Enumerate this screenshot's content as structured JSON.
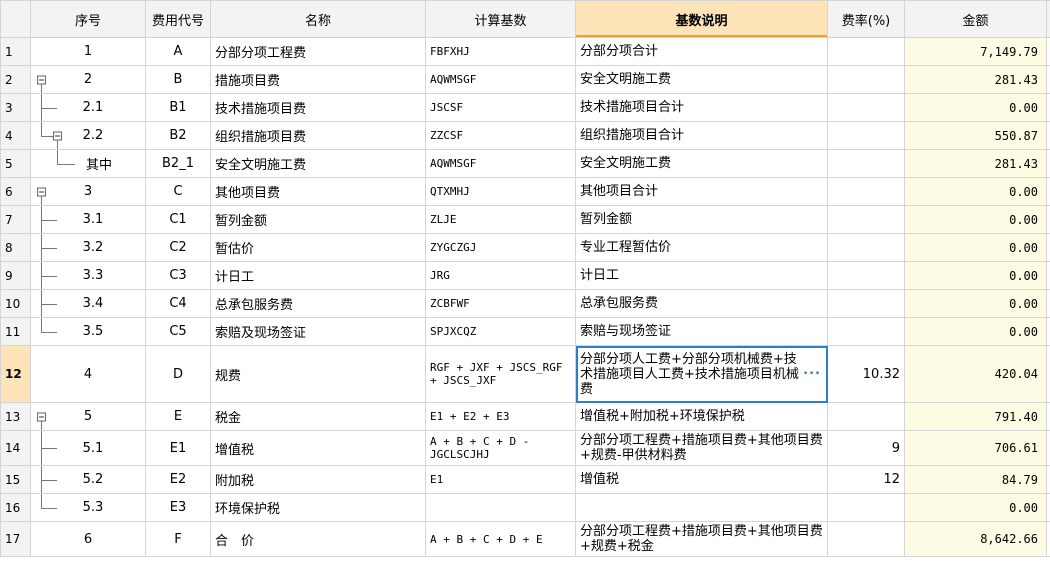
{
  "headers": {
    "rownum": "",
    "seq": "序号",
    "code": "费用代号",
    "name": "名称",
    "base": "计算基数",
    "desc": "基数说明",
    "rate": "费率(%)",
    "amount": "金额"
  },
  "selected_row": "12",
  "rows": [
    {
      "rn": "1",
      "seq": "1",
      "code": "A",
      "name": "分部分项工程费",
      "base": "FBFXHJ",
      "desc": "分部分项合计",
      "rate": "",
      "amount": "7,149.79"
    },
    {
      "rn": "2",
      "seq": "2",
      "code": "B",
      "name": "措施项目费",
      "base": "AQWMSGF",
      "desc": "安全文明施工费",
      "rate": "",
      "amount": "281.43"
    },
    {
      "rn": "3",
      "seq": "2.1",
      "code": "B1",
      "name": "技术措施项目费",
      "base": "JSCSF",
      "desc": "技术措施项目合计",
      "rate": "",
      "amount": "0.00"
    },
    {
      "rn": "4",
      "seq": "2.2",
      "code": "B2",
      "name": "组织措施项目费",
      "base": "ZZCSF",
      "desc": "组织措施项目合计",
      "rate": "",
      "amount": "550.87"
    },
    {
      "rn": "5",
      "seq": "其中",
      "code": "B2_1",
      "name": "安全文明施工费",
      "base": "AQWMSGF",
      "desc": "安全文明施工费",
      "rate": "",
      "amount": "281.43"
    },
    {
      "rn": "6",
      "seq": "3",
      "code": "C",
      "name": "其他项目费",
      "base": "QTXMHJ",
      "desc": "其他项目合计",
      "rate": "",
      "amount": "0.00"
    },
    {
      "rn": "7",
      "seq": "3.1",
      "code": "C1",
      "name": "暂列金额",
      "base": "ZLJE",
      "desc": "暂列金额",
      "rate": "",
      "amount": "0.00"
    },
    {
      "rn": "8",
      "seq": "3.2",
      "code": "C2",
      "name": "暂估价",
      "base": "ZYGCZGJ",
      "desc": "专业工程暂估价",
      "rate": "",
      "amount": "0.00"
    },
    {
      "rn": "9",
      "seq": "3.3",
      "code": "C3",
      "name": "计日工",
      "base": "JRG",
      "desc": "计日工",
      "rate": "",
      "amount": "0.00"
    },
    {
      "rn": "10",
      "seq": "3.4",
      "code": "C4",
      "name": "总承包服务费",
      "base": "ZCBFWF",
      "desc": "总承包服务费",
      "rate": "",
      "amount": "0.00"
    },
    {
      "rn": "11",
      "seq": "3.5",
      "code": "C5",
      "name": "索赔及现场签证",
      "base": "SPJXCQZ",
      "desc": "索赔与现场签证",
      "rate": "",
      "amount": "0.00"
    },
    {
      "rn": "12",
      "seq": "4",
      "code": "D",
      "name": "规费",
      "base": "RGF + JXF + JSCS_RGF + JSCS_JXF",
      "desc": "分部分项人工费+分部分项机械费+技术措施项目人工费+技术措施项目机械费",
      "rate": "10.32",
      "amount": "420.04"
    },
    {
      "rn": "13",
      "seq": "5",
      "code": "E",
      "name": "税金",
      "base": "E1 + E2 + E3",
      "desc": "增值税+附加税+环境保护税",
      "rate": "",
      "amount": "791.40"
    },
    {
      "rn": "14",
      "seq": "5.1",
      "code": "E1",
      "name": "增值税",
      "base": "A + B + C + D - JGCLSCJHJ",
      "desc": "分部分项工程费+措施项目费+其他项目费+规费-甲供材料费",
      "rate": "9",
      "amount": "706.61"
    },
    {
      "rn": "15",
      "seq": "5.2",
      "code": "E2",
      "name": "附加税",
      "base": "E1",
      "desc": "增值税",
      "rate": "12",
      "amount": "84.79"
    },
    {
      "rn": "16",
      "seq": "5.3",
      "code": "E3",
      "name": "环境保护税",
      "base": "",
      "desc": "",
      "rate": "",
      "amount": "0.00"
    },
    {
      "rn": "17",
      "seq": "6",
      "code": "F",
      "name": "合　价",
      "base": "A + B + C + D + E",
      "desc": "分部分项工程费+措施项目费+其他项目费+规费+税金",
      "rate": "",
      "amount": "8,642.66"
    }
  ]
}
